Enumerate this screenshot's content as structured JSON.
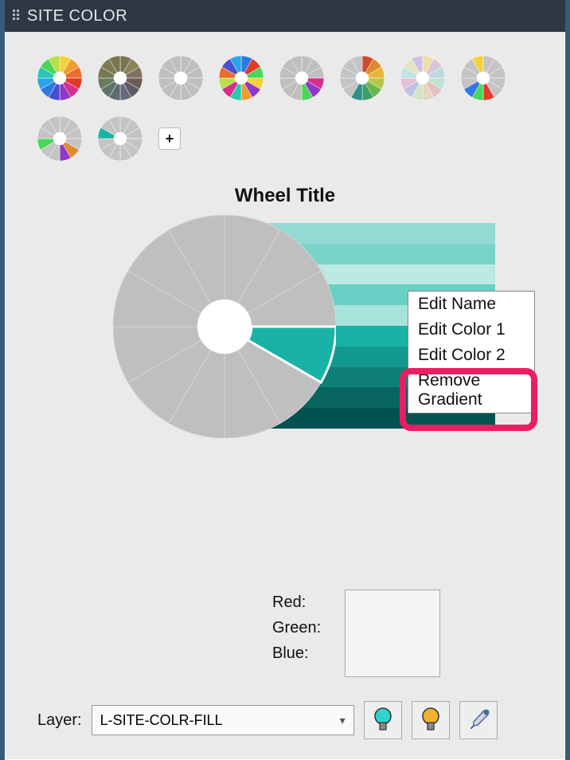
{
  "header": {
    "title": "SITE COLOR"
  },
  "presets": {
    "add_label": "+",
    "thumbs": [
      {
        "colors": [
          "#f3d23a",
          "#f19c2e",
          "#ec6c2b",
          "#e23a2a",
          "#d6308e",
          "#9038c7",
          "#4a4ed0",
          "#2e7ae0",
          "#2aa3e8",
          "#2bc7b3",
          "#4bd65a",
          "#b8e04b"
        ]
      },
      {
        "colors": [
          "#777552",
          "#8a8259",
          "#807060",
          "#6a5c58",
          "#5d5b67",
          "#666a7c",
          "#5f6c6e",
          "#617268",
          "#6a7a5e",
          "#747a58",
          "#7e7a55",
          "#7a7650"
        ]
      },
      {
        "colors": [
          "#bfbfbf",
          "#bfbfbf",
          "#bfbfbf",
          "#bfbfbf",
          "#bfbfbf",
          "#bfbfbf",
          "#bfbfbf",
          "#bfbfbf",
          "#bfbfbf",
          "#bfbfbf",
          "#bfbfbf",
          "#bfbfbf"
        ]
      },
      {
        "colors": [
          "#2e7ae0",
          "#e23a2a",
          "#4bd65a",
          "#f3d23a",
          "#9038c7",
          "#f19c2e",
          "#2bc7b3",
          "#d6308e",
          "#b8e04b",
          "#ec6c2b",
          "#4a4ed0",
          "#2aa3e8"
        ]
      },
      {
        "colors": [
          "#bfbfbf",
          "#bfbfbf",
          "#bfbfbf",
          "#d6308e",
          "#9038c7",
          "#4bd65a",
          "#bfbfbf",
          "#bfbfbf",
          "#bfbfbf",
          "#bfbfbf",
          "#bfbfbf",
          "#bfbfbf"
        ]
      },
      {
        "colors": [
          "#cf4a2e",
          "#e08a2e",
          "#e6b63a",
          "#b8c74a",
          "#6eb54e",
          "#3aa06a",
          "#2e8e8a",
          "#c4c4c4",
          "#c4c4c4",
          "#c4c4c4",
          "#c4c4c4",
          "#c4c4c4"
        ]
      },
      {
        "colors": [
          "#e9dfa8",
          "#d8c4d8",
          "#c0d8e4",
          "#c0e4d0",
          "#e4c0c0",
          "#e4d4c0",
          "#d4e4c0",
          "#c0c0e4",
          "#e4c0d8",
          "#c0e4e4",
          "#e4e4c0",
          "#d0c0e4"
        ]
      },
      {
        "colors": [
          "#c4c4c4",
          "#c4c4c4",
          "#c4c4c4",
          "#c4c4c4",
          "#c4c4c4",
          "#e23a2a",
          "#4bd65a",
          "#2e7ae0",
          "#c4c4c4",
          "#c4c4c4",
          "#c4c4c4",
          "#f3d23a"
        ]
      },
      {
        "colors": [
          "#c4c4c4",
          "#c4c4c4",
          "#c4c4c4",
          "#c4c4c4",
          "#e08a2e",
          "#9038c7",
          "#c4c4c4",
          "#c4c4c4",
          "#4bd65a",
          "#c4c4c4",
          "#c4c4c4",
          "#c4c4c4"
        ]
      },
      {
        "colors": [
          "#c4c4c4",
          "#c4c4c4",
          "#c4c4c4",
          "#c4c4c4",
          "#c4c4c4",
          "#c4c4c4",
          "#c4c4c4",
          "#c4c4c4",
          "#c4c4c4",
          "#18b3a6",
          "#c4c4c4",
          "#c4c4c4"
        ]
      }
    ]
  },
  "wheel": {
    "title": "Wheel Title",
    "gradient": [
      "#93dad2",
      "#78d4c9",
      "#bce9e2",
      "#6ad0c5",
      "#a6e3da",
      "#18b3a6",
      "#12998f",
      "#0d7f77",
      "#08655f",
      "#045250"
    ],
    "base_color": "#bfbfbf",
    "segment_color": "#18b3a6",
    "inner_color": "#ffffff"
  },
  "context_menu": {
    "items": [
      "Edit Name",
      "Edit Color 1",
      "Edit Color 2",
      "Remove Gradient"
    ],
    "highlighted": "Remove Gradient"
  },
  "rgb": {
    "red_label": "Red:",
    "green_label": "Green:",
    "blue_label": "Blue:"
  },
  "layer": {
    "label": "Layer:",
    "selected": "L-SITE-COLR-FILL"
  },
  "icons": {
    "bulb_teal": "#2dd3cf",
    "bulb_amber": "#f0b42c",
    "eyedrop": "#4a6a9a"
  }
}
